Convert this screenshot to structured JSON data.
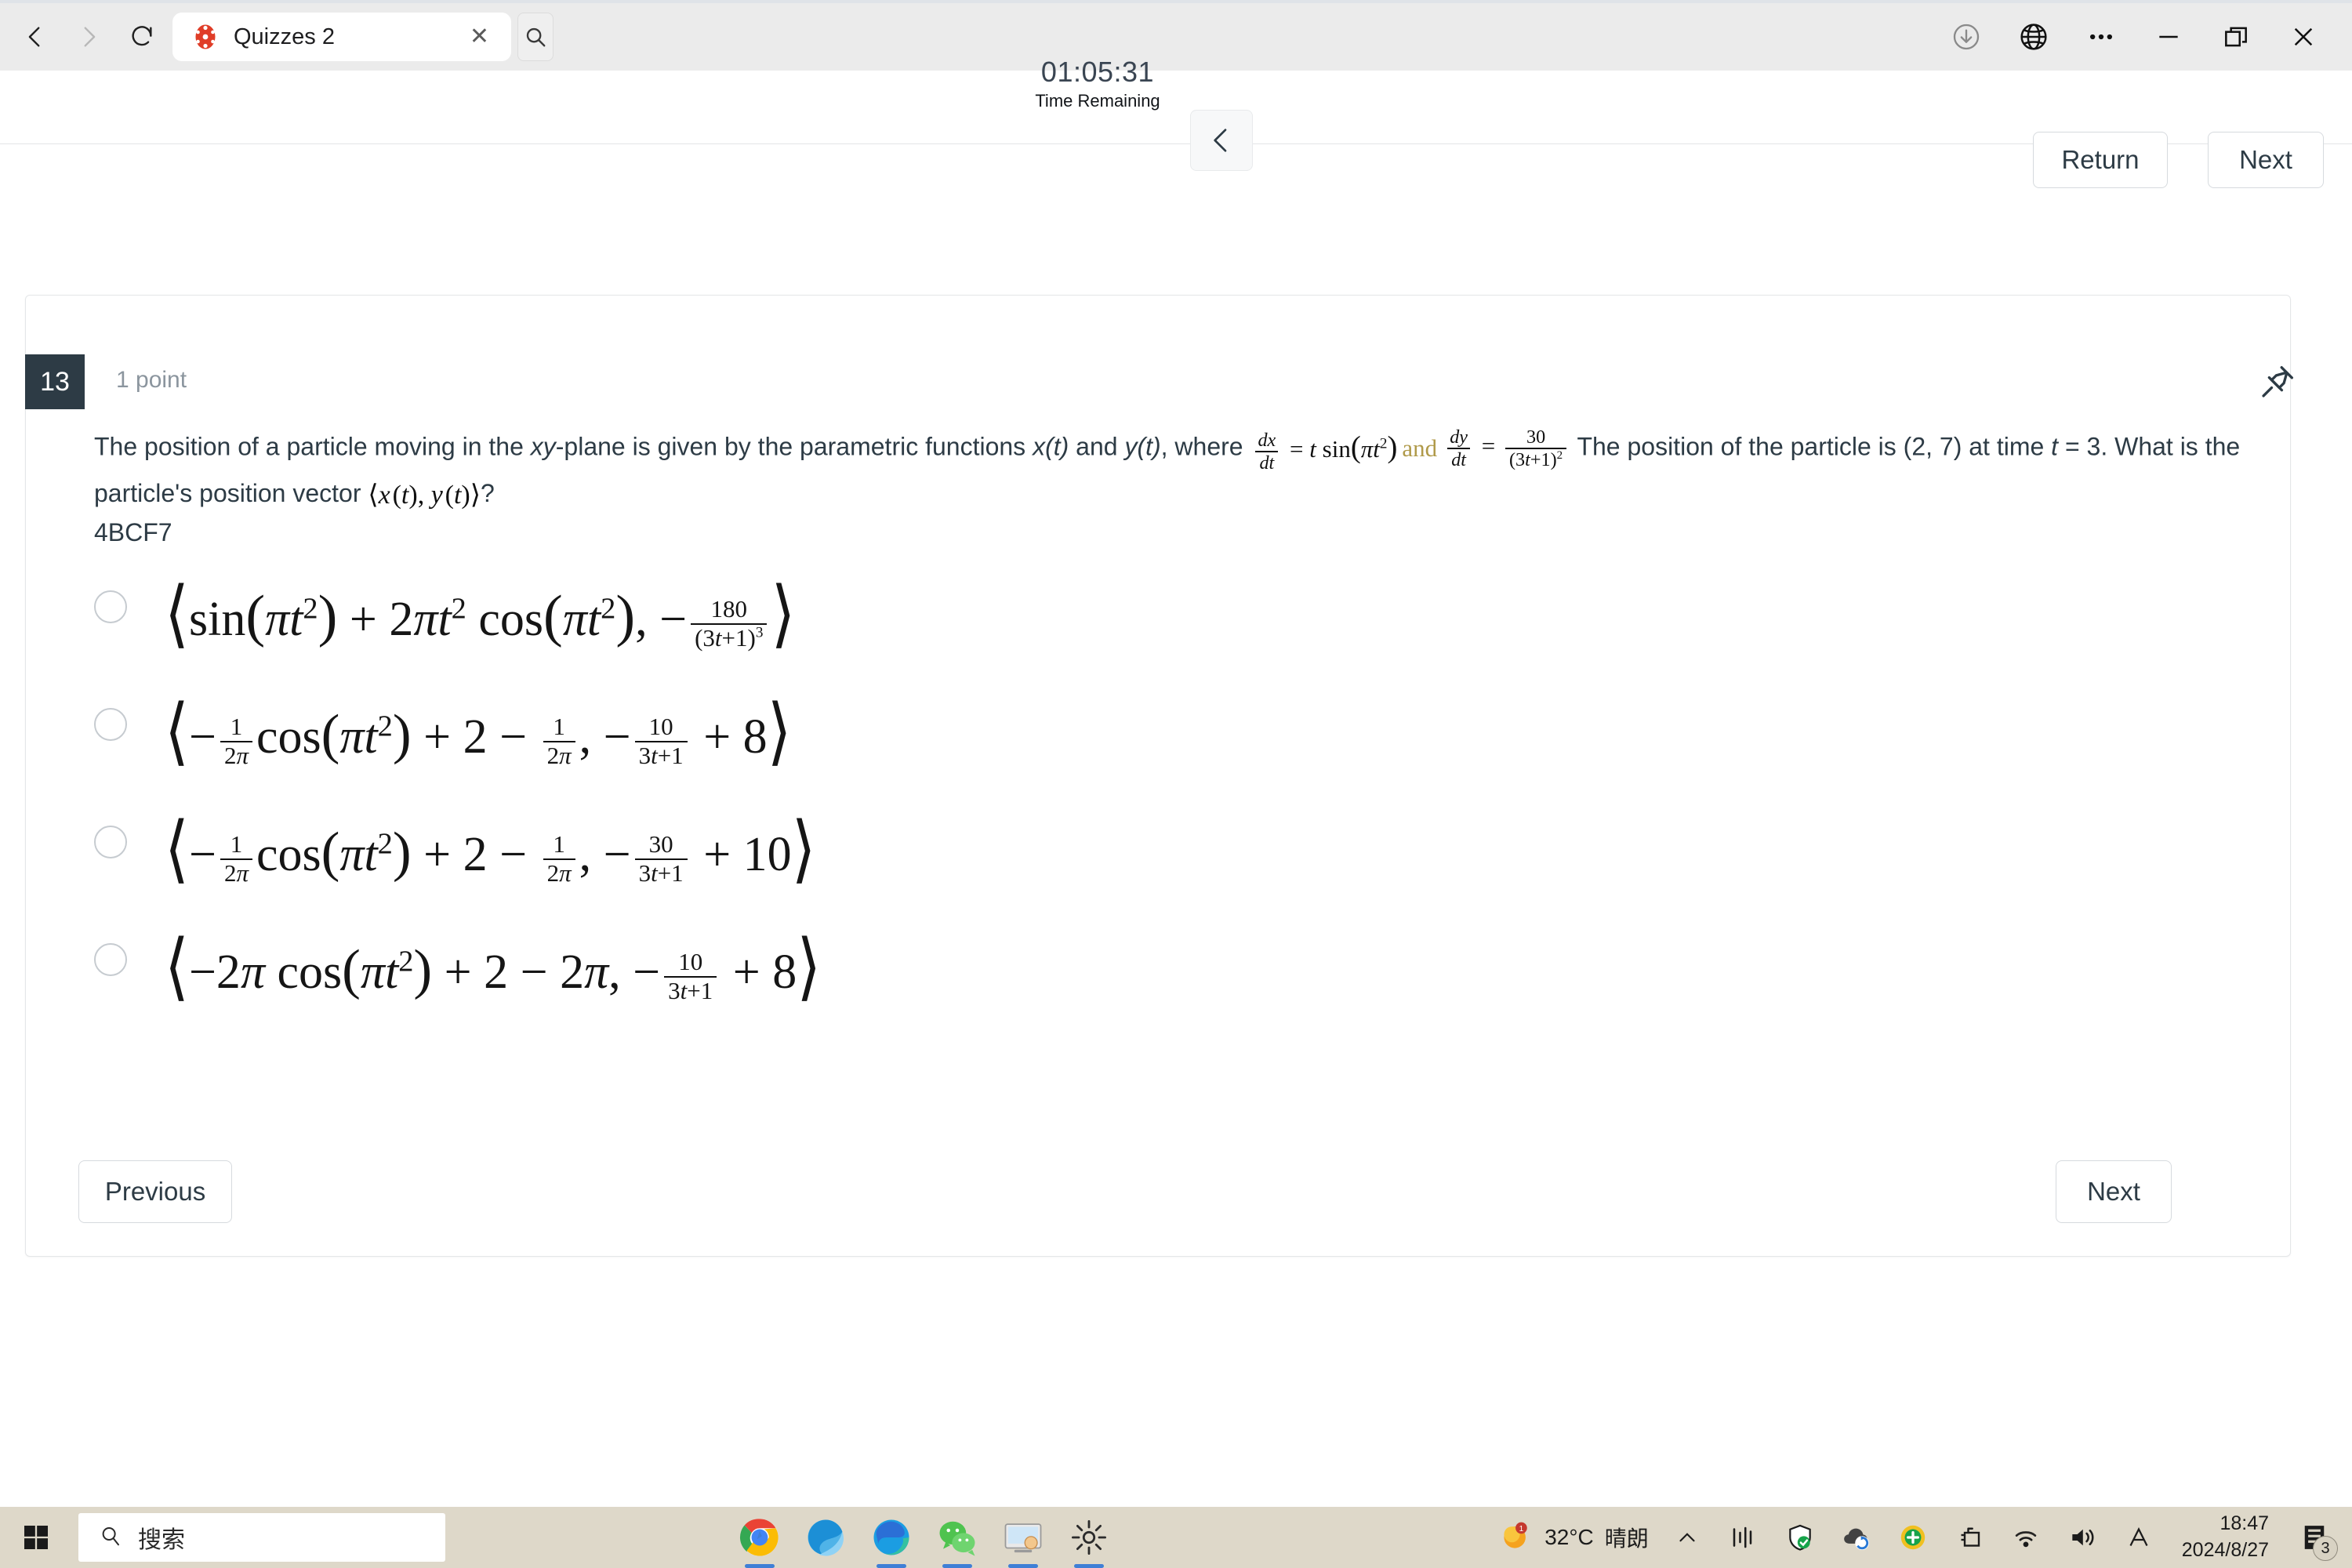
{
  "browser": {
    "nav": {
      "back_icon": "chevron-left-icon",
      "forward_icon": "chevron-right-icon",
      "reload_icon": "reload-icon"
    },
    "tab": {
      "favicon": "canvas-lms-icon",
      "title": "Quizzes 2",
      "close_label": "✕",
      "search_icon": "search-icon"
    },
    "window_controls": {
      "downloads_icon": "download-circle-icon",
      "translate_icon": "globe-icon",
      "more_icon": "more-horizontal-icon",
      "minimize_icon": "minimize-icon",
      "restore_icon": "restore-window-icon",
      "close_icon": "close-icon"
    }
  },
  "quiz_header": {
    "timer_value": "01:05:31",
    "timer_label": "Time Remaining",
    "collapse_icon": "chevron-left-icon",
    "return_label": "Return",
    "next_label": "Next"
  },
  "question": {
    "number": "13",
    "points": "1 point",
    "pin_icon": "pin-icon",
    "text_part1": "The position of a particle moving in the ",
    "text_xy": "xy",
    "text_part2": "-plane is given by the parametric functions ",
    "text_xt": "x(t)",
    "text_and": " and ",
    "text_yt": "y(t)",
    "text_part3": ", where ",
    "formula_dx": "dx/dt = t sin(πt²)",
    "formula_and": "and",
    "formula_dy": "dy/dt = 30/(3t+1)²",
    "text_part4": " The position of the particle is (2, 7) at time ",
    "text_t": "t",
    "text_part5": " = 3. What is the particle's position vector ",
    "vector_notation": "⟨x(t), y(t)⟩",
    "text_part6": "?",
    "code": "4BCF7"
  },
  "options": [
    {
      "id": "option-a",
      "latex": "⟨sin(πt²) + 2πt² cos(πt²), −180/(3t+1)³⟩",
      "selected": false
    },
    {
      "id": "option-b",
      "latex": "⟨−(1/2π)cos(πt²) + 2 − 1/2π, −10/(3t+1) + 8⟩",
      "selected": false
    },
    {
      "id": "option-c",
      "latex": "⟨−(1/2π)cos(πt²) + 2 − 1/2π, −30/(3t+1) + 10⟩",
      "selected": false
    },
    {
      "id": "option-d",
      "latex": "⟨−2π cos(πt²) + 2 − 2π, −10/(3t+1) + 8⟩",
      "selected": false
    }
  ],
  "card_footer": {
    "previous_label": "Previous",
    "next_label": "Next"
  },
  "taskbar": {
    "start_icon": "windows-start-icon",
    "search_placeholder": "搜索",
    "search_icon": "search-icon",
    "apps": [
      {
        "name": "chrome-taskbar-icon",
        "active": true
      },
      {
        "name": "firefox-taskbar-icon",
        "active": false
      },
      {
        "name": "edge-taskbar-icon",
        "active": true
      },
      {
        "name": "wechat-taskbar-icon",
        "active": true
      },
      {
        "name": "remote-desktop-taskbar-icon",
        "active": true
      },
      {
        "name": "settings-taskbar-icon",
        "active": true
      }
    ],
    "weather": {
      "temperature": "32°C",
      "condition": "晴朗"
    },
    "tray_icons": [
      "show-hidden-icons-chevron",
      "audio-mixer-icon",
      "security-shield-icon",
      "onedrive-sync-icon",
      "update-icon",
      "usb-eject-icon",
      "wifi-icon",
      "volume-icon",
      "ime-language-icon"
    ],
    "clock": {
      "time": "18:47",
      "date": "2024/8/27"
    },
    "notification_count": "3"
  },
  "colors": {
    "canvas_dark": "#2d3b45",
    "muted_text": "#8b959e",
    "taskbar_bg": "#ded8c9",
    "browser_chrome": "#ebebeb",
    "accent_blue": "#3f7fd6"
  }
}
